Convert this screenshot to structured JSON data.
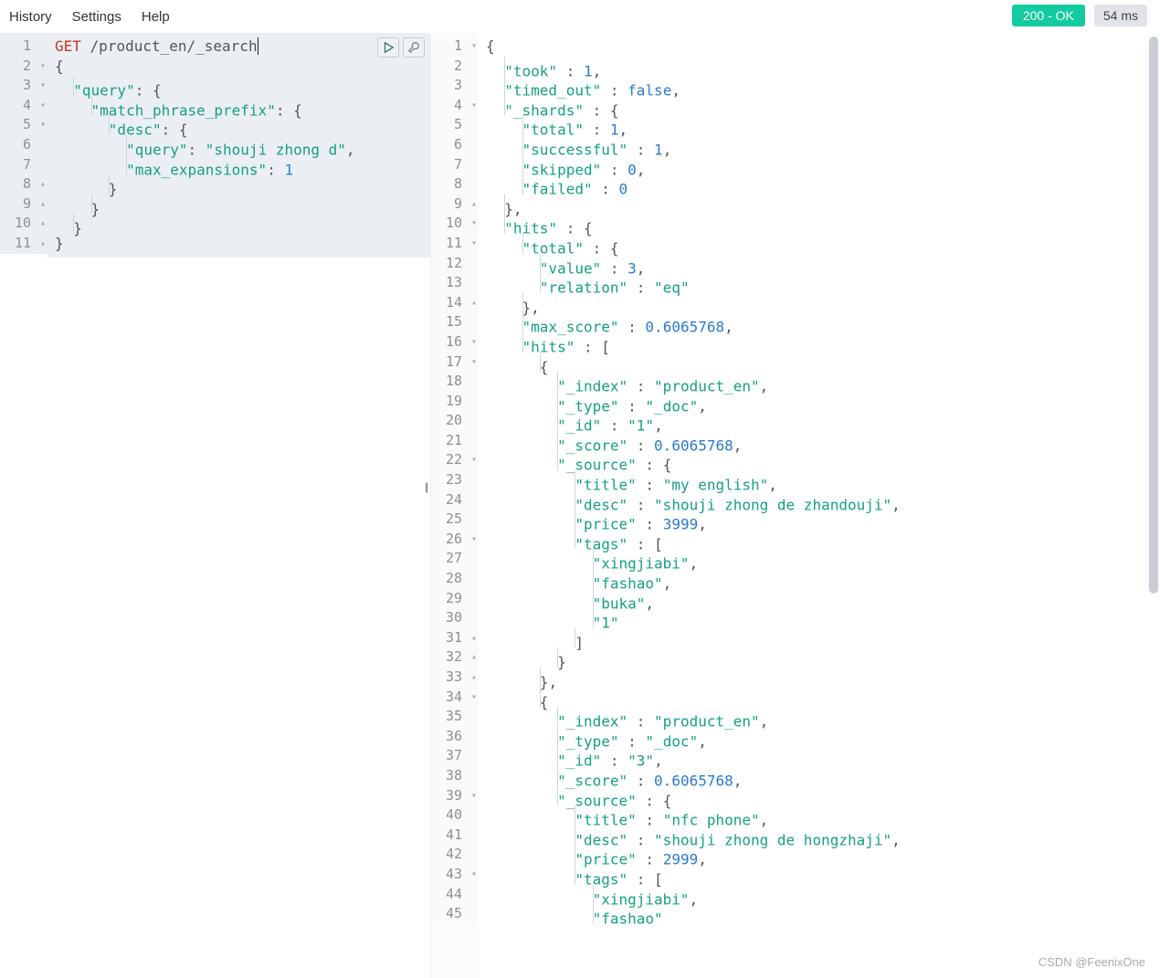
{
  "menu": {
    "history": "History",
    "settings": "Settings",
    "help": "Help"
  },
  "status": {
    "ok": "200 - OK",
    "time": "54 ms"
  },
  "left": {
    "lines": [
      {
        "n": "1",
        "fold": "",
        "html": "<span class='tok-method'>GET</span> <span class='tok-url'>/product_en/_search</span><span class='cursor'></span>"
      },
      {
        "n": "2",
        "fold": "fold",
        "html": "<span class='tok-brace'>{</span>"
      },
      {
        "n": "3",
        "fold": "fold",
        "html": "  <span class='guide'></span><span class='tok-key'>\"query\"</span><span class='tok-punct'>: {</span>"
      },
      {
        "n": "4",
        "fold": "fold",
        "html": "    <span class='guide'></span><span class='tok-key'>\"match_phrase_prefix\"</span><span class='tok-punct'>: {</span>"
      },
      {
        "n": "5",
        "fold": "fold",
        "html": "      <span class='guide'></span><span class='tok-key'>\"desc\"</span><span class='tok-punct'>: {</span>"
      },
      {
        "n": "6",
        "fold": "",
        "html": "        <span class='guide'></span><span class='tok-key'>\"query\"</span><span class='tok-punct'>: </span><span class='tok-str'>\"shouji zhong d\"</span><span class='tok-punct'>,</span>"
      },
      {
        "n": "7",
        "fold": "",
        "html": "        <span class='guide'></span><span class='tok-key'>\"max_expansions\"</span><span class='tok-punct'>: </span><span class='tok-num'>1</span>"
      },
      {
        "n": "8",
        "fold": "foldup",
        "html": "      <span class='guide'></span><span class='tok-brace'>}</span>"
      },
      {
        "n": "9",
        "fold": "foldup",
        "html": "    <span class='guide'></span><span class='tok-brace'>}</span>"
      },
      {
        "n": "10",
        "fold": "foldup",
        "html": "  <span class='guide'></span><span class='tok-brace'>}</span>"
      },
      {
        "n": "11",
        "fold": "foldup",
        "html": "<span class='tok-brace'>}</span>"
      }
    ]
  },
  "right": {
    "lines": [
      {
        "n": "1",
        "fold": "fold",
        "html": "<span class='tok-brace'>{</span>"
      },
      {
        "n": "2",
        "fold": "",
        "html": "  <span class='guide'></span><span class='tok-key'>\"took\"</span> <span class='tok-punct'>:</span> <span class='tok-num'>1</span><span class='tok-punct'>,</span>"
      },
      {
        "n": "3",
        "fold": "",
        "html": "  <span class='guide'></span><span class='tok-key'>\"timed_out\"</span> <span class='tok-punct'>:</span> <span class='tok-bool'>false</span><span class='tok-punct'>,</span>"
      },
      {
        "n": "4",
        "fold": "fold",
        "html": "  <span class='guide'></span><span class='tok-key'>\"_shards\"</span> <span class='tok-punct'>:</span> <span class='tok-brace'>{</span>"
      },
      {
        "n": "5",
        "fold": "",
        "html": "    <span class='guide'></span><span class='tok-key'>\"total\"</span> <span class='tok-punct'>:</span> <span class='tok-num'>1</span><span class='tok-punct'>,</span>"
      },
      {
        "n": "6",
        "fold": "",
        "html": "    <span class='guide'></span><span class='tok-key'>\"successful\"</span> <span class='tok-punct'>:</span> <span class='tok-num'>1</span><span class='tok-punct'>,</span>"
      },
      {
        "n": "7",
        "fold": "",
        "html": "    <span class='guide'></span><span class='tok-key'>\"skipped\"</span> <span class='tok-punct'>:</span> <span class='tok-num'>0</span><span class='tok-punct'>,</span>"
      },
      {
        "n": "8",
        "fold": "",
        "html": "    <span class='guide'></span><span class='tok-key'>\"failed\"</span> <span class='tok-punct'>:</span> <span class='tok-num'>0</span>"
      },
      {
        "n": "9",
        "fold": "foldup",
        "html": "  <span class='guide'></span><span class='tok-brace'>}</span><span class='tok-punct'>,</span>"
      },
      {
        "n": "10",
        "fold": "fold",
        "html": "  <span class='guide'></span><span class='tok-key'>\"hits\"</span> <span class='tok-punct'>:</span> <span class='tok-brace'>{</span>"
      },
      {
        "n": "11",
        "fold": "fold",
        "html": "    <span class='guide'></span><span class='tok-key'>\"total\"</span> <span class='tok-punct'>:</span> <span class='tok-brace'>{</span>"
      },
      {
        "n": "12",
        "fold": "",
        "html": "      <span class='guide'></span><span class='tok-key'>\"value\"</span> <span class='tok-punct'>:</span> <span class='tok-num'>3</span><span class='tok-punct'>,</span>"
      },
      {
        "n": "13",
        "fold": "",
        "html": "      <span class='guide'></span><span class='tok-key'>\"relation\"</span> <span class='tok-punct'>:</span> <span class='tok-str'>\"eq\"</span>"
      },
      {
        "n": "14",
        "fold": "foldup",
        "html": "    <span class='guide'></span><span class='tok-brace'>}</span><span class='tok-punct'>,</span>"
      },
      {
        "n": "15",
        "fold": "",
        "html": "    <span class='guide'></span><span class='tok-key'>\"max_score\"</span> <span class='tok-punct'>:</span> <span class='tok-num'>0.6065768</span><span class='tok-punct'>,</span>"
      },
      {
        "n": "16",
        "fold": "fold",
        "html": "    <span class='guide'></span><span class='tok-key'>\"hits\"</span> <span class='tok-punct'>:</span> <span class='tok-brace'>[</span>"
      },
      {
        "n": "17",
        "fold": "fold",
        "html": "      <span class='guide'></span><span class='tok-brace'>{</span>"
      },
      {
        "n": "18",
        "fold": "",
        "html": "        <span class='guide'></span><span class='tok-key'>\"_index\"</span> <span class='tok-punct'>:</span> <span class='tok-str'>\"product_en\"</span><span class='tok-punct'>,</span>"
      },
      {
        "n": "19",
        "fold": "",
        "html": "        <span class='guide'></span><span class='tok-key'>\"_type\"</span> <span class='tok-punct'>:</span> <span class='tok-str'>\"_doc\"</span><span class='tok-punct'>,</span>"
      },
      {
        "n": "20",
        "fold": "",
        "html": "        <span class='guide'></span><span class='tok-key'>\"_id\"</span> <span class='tok-punct'>:</span> <span class='tok-str'>\"1\"</span><span class='tok-punct'>,</span>"
      },
      {
        "n": "21",
        "fold": "",
        "html": "        <span class='guide'></span><span class='tok-key'>\"_score\"</span> <span class='tok-punct'>:</span> <span class='tok-num'>0.6065768</span><span class='tok-punct'>,</span>"
      },
      {
        "n": "22",
        "fold": "fold",
        "html": "        <span class='guide'></span><span class='tok-key'>\"_source\"</span> <span class='tok-punct'>:</span> <span class='tok-brace'>{</span>"
      },
      {
        "n": "23",
        "fold": "",
        "html": "          <span class='guide'></span><span class='tok-key'>\"title\"</span> <span class='tok-punct'>:</span> <span class='tok-str'>\"my english\"</span><span class='tok-punct'>,</span>"
      },
      {
        "n": "24",
        "fold": "",
        "html": "          <span class='guide'></span><span class='tok-key'>\"desc\"</span> <span class='tok-punct'>:</span> <span class='tok-str'>\"shouji zhong de zhandouji\"</span><span class='tok-punct'>,</span>"
      },
      {
        "n": "25",
        "fold": "",
        "html": "          <span class='guide'></span><span class='tok-key'>\"price\"</span> <span class='tok-punct'>:</span> <span class='tok-num'>3999</span><span class='tok-punct'>,</span>"
      },
      {
        "n": "26",
        "fold": "fold",
        "html": "          <span class='guide'></span><span class='tok-key'>\"tags\"</span> <span class='tok-punct'>:</span> <span class='tok-brace'>[</span>"
      },
      {
        "n": "27",
        "fold": "",
        "html": "            <span class='guide'></span><span class='tok-str'>\"xingjiabi\"</span><span class='tok-punct'>,</span>"
      },
      {
        "n": "28",
        "fold": "",
        "html": "            <span class='guide'></span><span class='tok-str'>\"fashao\"</span><span class='tok-punct'>,</span>"
      },
      {
        "n": "29",
        "fold": "",
        "html": "            <span class='guide'></span><span class='tok-str'>\"buka\"</span><span class='tok-punct'>,</span>"
      },
      {
        "n": "30",
        "fold": "",
        "html": "            <span class='guide'></span><span class='tok-str'>\"1\"</span>"
      },
      {
        "n": "31",
        "fold": "foldup",
        "html": "          <span class='guide'></span><span class='tok-brace'>]</span>"
      },
      {
        "n": "32",
        "fold": "foldup",
        "html": "        <span class='guide'></span><span class='tok-brace'>}</span>"
      },
      {
        "n": "33",
        "fold": "foldup",
        "html": "      <span class='guide'></span><span class='tok-brace'>}</span><span class='tok-punct'>,</span>"
      },
      {
        "n": "34",
        "fold": "fold",
        "html": "      <span class='guide'></span><span class='tok-brace'>{</span>"
      },
      {
        "n": "35",
        "fold": "",
        "html": "        <span class='guide'></span><span class='tok-key'>\"_index\"</span> <span class='tok-punct'>:</span> <span class='tok-str'>\"product_en\"</span><span class='tok-punct'>,</span>"
      },
      {
        "n": "36",
        "fold": "",
        "html": "        <span class='guide'></span><span class='tok-key'>\"_type\"</span> <span class='tok-punct'>:</span> <span class='tok-str'>\"_doc\"</span><span class='tok-punct'>,</span>"
      },
      {
        "n": "37",
        "fold": "",
        "html": "        <span class='guide'></span><span class='tok-key'>\"_id\"</span> <span class='tok-punct'>:</span> <span class='tok-str'>\"3\"</span><span class='tok-punct'>,</span>"
      },
      {
        "n": "38",
        "fold": "",
        "html": "        <span class='guide'></span><span class='tok-key'>\"_score\"</span> <span class='tok-punct'>:</span> <span class='tok-num'>0.6065768</span><span class='tok-punct'>,</span>"
      },
      {
        "n": "39",
        "fold": "fold",
        "html": "        <span class='guide'></span><span class='tok-key'>\"_source\"</span> <span class='tok-punct'>:</span> <span class='tok-brace'>{</span>"
      },
      {
        "n": "40",
        "fold": "",
        "html": "          <span class='guide'></span><span class='tok-key'>\"title\"</span> <span class='tok-punct'>:</span> <span class='tok-str'>\"nfc phone\"</span><span class='tok-punct'>,</span>"
      },
      {
        "n": "41",
        "fold": "",
        "html": "          <span class='guide'></span><span class='tok-key'>\"desc\"</span> <span class='tok-punct'>:</span> <span class='tok-str'>\"shouji zhong de hongzhaji\"</span><span class='tok-punct'>,</span>"
      },
      {
        "n": "42",
        "fold": "",
        "html": "          <span class='guide'></span><span class='tok-key'>\"price\"</span> <span class='tok-punct'>:</span> <span class='tok-num'>2999</span><span class='tok-punct'>,</span>"
      },
      {
        "n": "43",
        "fold": "fold",
        "html": "          <span class='guide'></span><span class='tok-key'>\"tags\"</span> <span class='tok-punct'>:</span> <span class='tok-brace'>[</span>"
      },
      {
        "n": "44",
        "fold": "",
        "html": "            <span class='guide'></span><span class='tok-str'>\"xingjiabi\"</span><span class='tok-punct'>,</span>"
      },
      {
        "n": "45",
        "fold": "",
        "html": "            <span class='guide'></span><span class='tok-str'>\"fashao\"</span>"
      }
    ]
  },
  "watermark": "CSDN @FeenixOne"
}
